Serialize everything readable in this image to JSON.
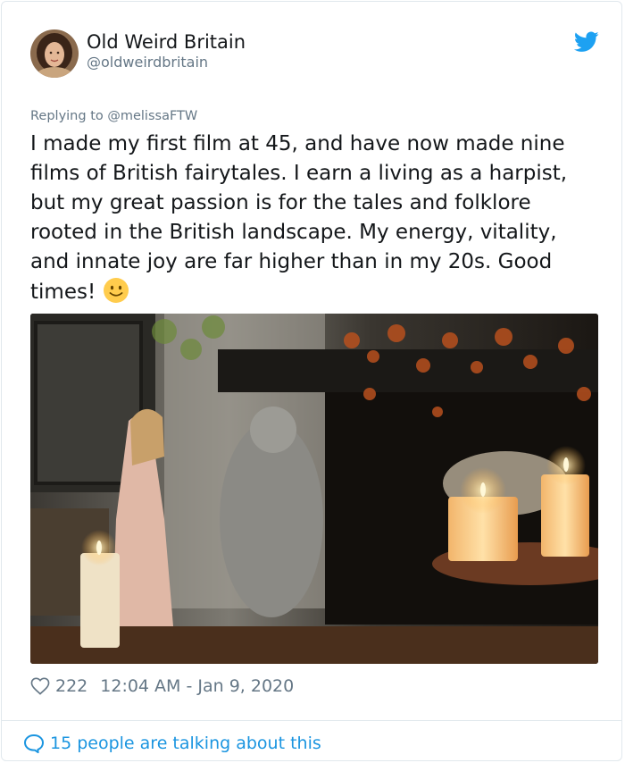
{
  "author": {
    "display_name": "Old Weird Britain",
    "handle": "@oldweirdbritain"
  },
  "reply": {
    "prefix": "Replying to ",
    "to": "@melissaFTW"
  },
  "tweet": {
    "text": "I made my first film at 45, and have now made nine films of British fairytales. I earn a living as a harpist, but my great passion is for the tales and folklore rooted in the British landscape. My energy, vitality, and innate joy are far higher than in my 20s. Good times!",
    "emoji": "slightly-smiling-face"
  },
  "stats": {
    "likes": "222",
    "timestamp": "12:04 AM - Jan 9, 2020"
  },
  "footer": {
    "conversation": "15 people are talking about this"
  },
  "colors": {
    "brand": "#1da1f2",
    "link": "#1b95e0",
    "muted": "#657786",
    "text": "#14171a"
  },
  "icons": [
    "twitter-bird-icon",
    "heart-icon",
    "speech-bubble-icon",
    "smiley-emoji"
  ]
}
